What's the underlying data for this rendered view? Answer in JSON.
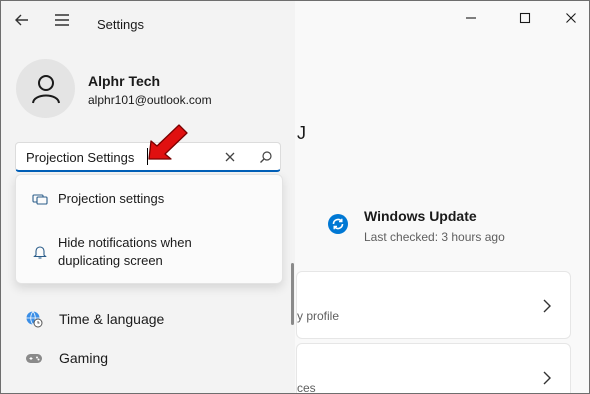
{
  "app": {
    "title": "Settings"
  },
  "profile": {
    "name": "Alphr Tech",
    "email": "alphr101@outlook.com"
  },
  "search": {
    "value": "Projection Settings"
  },
  "suggestions": [
    {
      "label": "Projection settings",
      "icon": "display-projection-icon"
    },
    {
      "label": "Hide notifications when duplicating screen",
      "icon": "bell-icon"
    }
  ],
  "nav": [
    {
      "label": "Time & language",
      "icon": "globe-clock-icon"
    },
    {
      "label": "Gaming",
      "icon": "gamepad-icon"
    }
  ],
  "main": {
    "heading_fragment": "J",
    "update": {
      "title": "Windows Update",
      "subtitle": "Last checked: 3 hours ago"
    },
    "cards": [
      {
        "text_fragment": "y profile"
      },
      {
        "text_fragment": "ces"
      }
    ]
  },
  "colors": {
    "accent": "#005fb8",
    "arrow": "#e01010",
    "update_icon": "#0078d4"
  }
}
